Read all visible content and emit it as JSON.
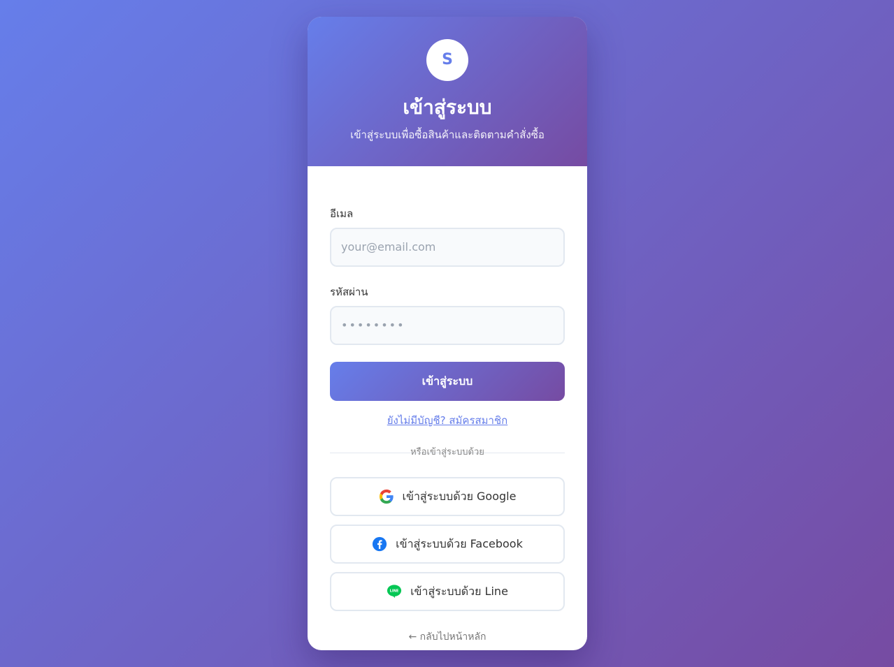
{
  "header": {
    "logo_letter": "S",
    "title": "เข้าสู่ระบบ",
    "subtitle": "เข้าสู่ระบบเพื่อซื้อสินค้าและติดตามคำสั่งซื้อ"
  },
  "form": {
    "email_label": "อีเมล",
    "email_placeholder": "your@email.com",
    "password_label": "รหัสผ่าน",
    "password_placeholder": "••••••••",
    "submit_label": "เข้าสู่ระบบ"
  },
  "signup_link": "ยังไม่มีบัญชี? สมัครสมาชิก",
  "divider_text": "หรือเข้าสู่ระบบด้วย",
  "social": {
    "google_label": "เข้าสู่ระบบด้วย Google",
    "facebook_label": "เข้าสู่ระบบด้วย Facebook",
    "line_label": "เข้าสู่ระบบด้วย Line"
  },
  "back_link": "← กลับไปหน้าหลัก",
  "colors": {
    "gradient_start": "#667eea",
    "gradient_end": "#764ba2",
    "facebook": "#1877f2",
    "line": "#06c755"
  }
}
